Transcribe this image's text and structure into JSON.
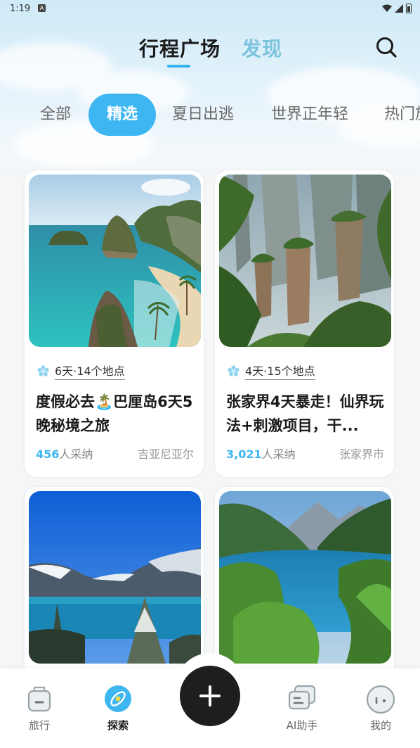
{
  "status_bar": {
    "time": "1:19",
    "indicator": "A"
  },
  "header": {
    "tabs": [
      {
        "label": "行程广场",
        "active": true
      },
      {
        "label": "发现",
        "active": false
      }
    ],
    "search_icon": "search-icon"
  },
  "categories": [
    {
      "label": "全部",
      "active": false
    },
    {
      "label": "精选",
      "active": true
    },
    {
      "label": "夏日出逃",
      "active": false
    },
    {
      "label": "世界正年轻",
      "active": false
    },
    {
      "label": "热门旅",
      "active": false
    }
  ],
  "cards": [
    {
      "meta": "6天·14个地点",
      "title": "度假必去🏝️巴厘岛6天5晚秘境之旅",
      "adopt_count": "456",
      "adopt_label": "人采纳",
      "location": "吉亚尼亚尔"
    },
    {
      "meta": "4天·15个地点",
      "title": "张家界4天暴走！仙界玩法+刺激项目，干...",
      "adopt_count": "3,021",
      "adopt_label": "人采纳",
      "location": "张家界市"
    },
    {
      "meta": "",
      "title": "",
      "adopt_count": "",
      "adopt_label": "",
      "location": ""
    },
    {
      "meta": "",
      "title": "",
      "adopt_count": "",
      "adopt_label": "",
      "location": ""
    }
  ],
  "bottom_nav": [
    {
      "label": "旅行",
      "icon": "suitcase-icon",
      "active": false
    },
    {
      "label": "探索",
      "icon": "compass-icon",
      "active": true
    },
    {
      "label": "",
      "icon": "plus-icon",
      "active": false
    },
    {
      "label": "AI助手",
      "icon": "chat-icon",
      "active": false
    },
    {
      "label": "我的",
      "icon": "profile-icon",
      "active": false
    }
  ],
  "colors": {
    "accent": "#3eb6f1",
    "fab": "#1e1e1e",
    "inactive_tab": "#7cc4de"
  }
}
